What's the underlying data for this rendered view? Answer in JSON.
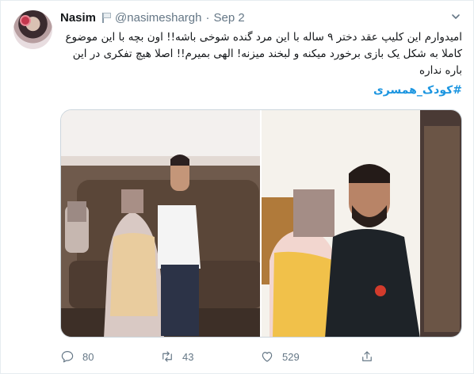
{
  "author": {
    "display_name": "Nasim",
    "handle": "@nasimeshargh",
    "separator": "·",
    "date": "Sep 2"
  },
  "tweet": {
    "text": "امیدوارم این کلیپ عقد دختر ۹ ساله با این مرد گنده شوخی باشه!! اون بچه با این موضوع کاملا به شکل یک بازی برخورد میکنه و لبخند میزنه! الهی بمیرم!! اصلا هیچ تفکری در این باره نداره",
    "hashtag": "#کودک_همسری"
  },
  "media": {
    "photos": [
      "photo-left",
      "photo-right"
    ]
  },
  "actions": {
    "replies": "80",
    "retweets": "43",
    "likes": "529"
  },
  "icons": [
    "flag-icon",
    "chevron-down-icon",
    "reply-icon",
    "retweet-icon",
    "like-icon",
    "share-icon"
  ],
  "colors": {
    "link": "#1b95e0",
    "muted": "#657786",
    "border": "#e6ecf0"
  }
}
